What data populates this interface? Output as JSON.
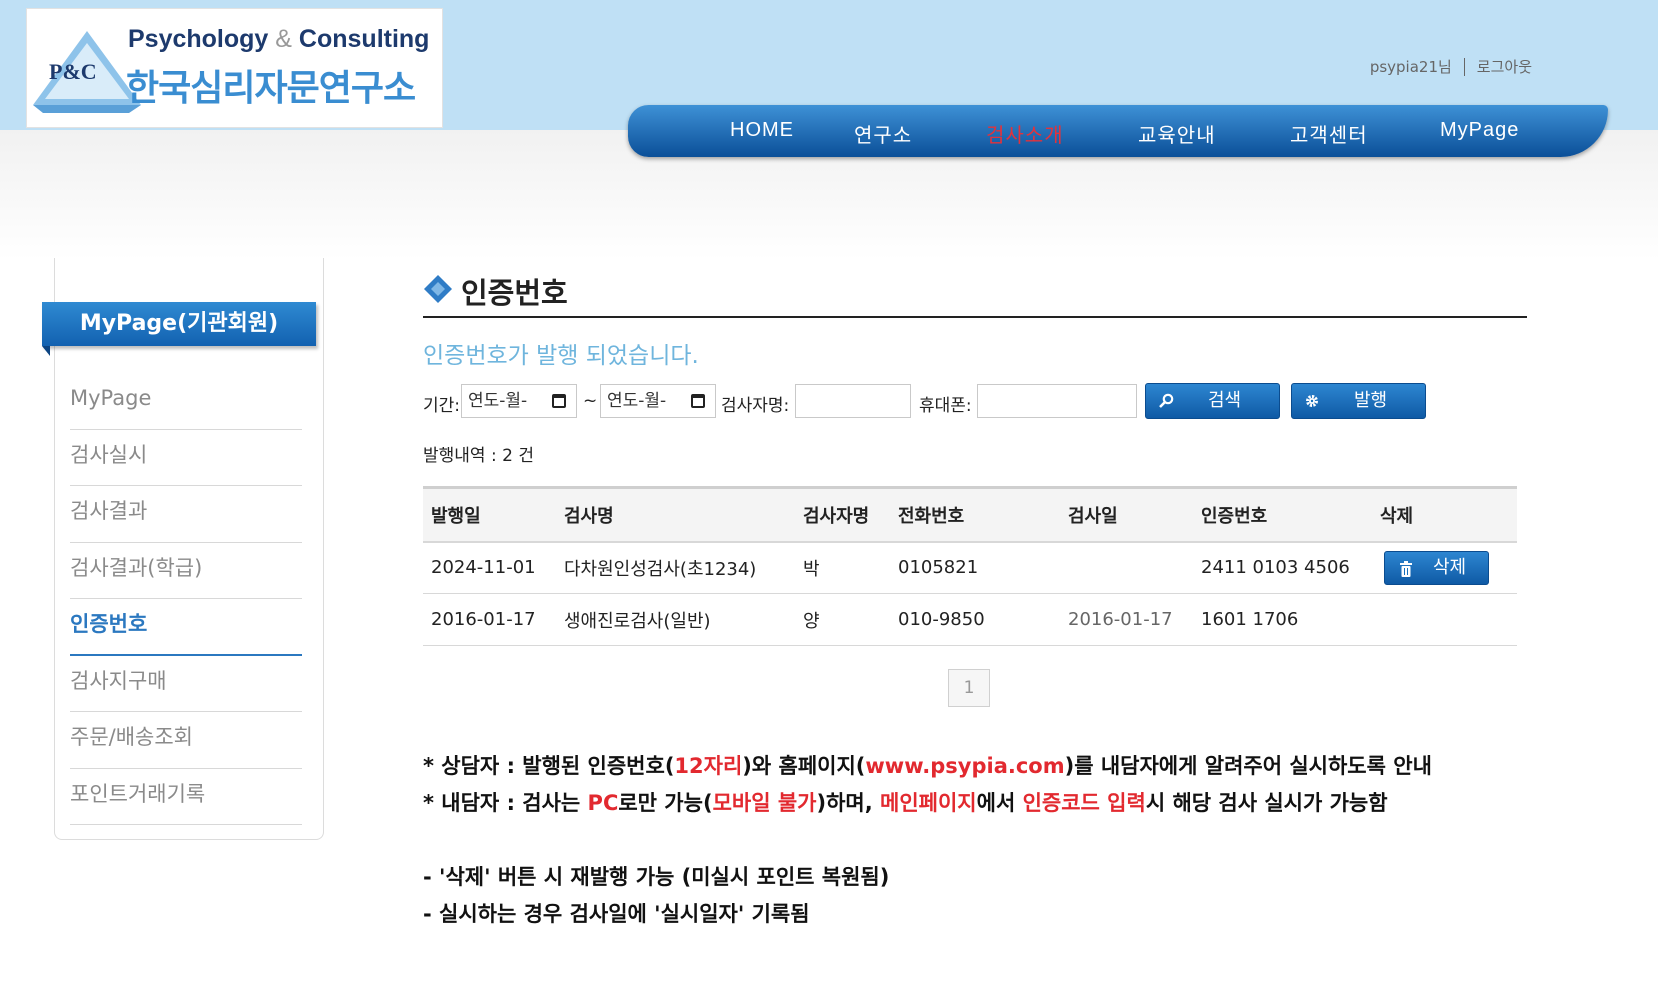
{
  "header": {
    "logo_mark_text": "P&C",
    "logo_sub_left": "Psychology",
    "logo_sub_amp": "&",
    "logo_sub_right": "Consulting",
    "logo_main": "한국심리자문연구소",
    "user_name": "psypia21님",
    "logout_label": "로그아웃"
  },
  "nav": {
    "items": [
      {
        "label": "HOME"
      },
      {
        "label": "연구소"
      },
      {
        "label": "검사소개"
      },
      {
        "label": "교육안내"
      },
      {
        "label": "고객센터"
      },
      {
        "label": "MyPage"
      }
    ],
    "active_color": "#e3323b"
  },
  "sidebar": {
    "title": "MyPage(기관회원)",
    "items": [
      {
        "label": "MyPage"
      },
      {
        "label": "검사실시"
      },
      {
        "label": "검사결과"
      },
      {
        "label": "검사결과(학급)"
      },
      {
        "label": "인증번호"
      },
      {
        "label": "검사지구매"
      },
      {
        "label": "주문/배송조회"
      },
      {
        "label": "포인트거래기록"
      }
    ],
    "active_index": 4
  },
  "main": {
    "title": "인증번호",
    "notice": "인증번호가 발행 되었습니다.",
    "filter": {
      "period_label": "기간:",
      "date_placeholder": "연도-월-",
      "tilde": "~",
      "name_label": "검사자명:",
      "phone_label": "휴대폰:",
      "search_button": "검색",
      "issue_button": "발행"
    },
    "count_text": "발행내역 : 2 건",
    "table": {
      "headers": [
        "발행일",
        "검사명",
        "검사자명",
        "전화번호",
        "검사일",
        "인증번호",
        "삭제"
      ],
      "rows": [
        {
          "issued": "2024-11-01",
          "test": "다차원인성검사(초1234)",
          "name": "박",
          "phone": "0105821",
          "tested": "",
          "code": "2411 0103 4506",
          "delete": "삭제"
        },
        {
          "issued": "2016-01-17",
          "test": "생애진로검사(일반)",
          "name": "양",
          "phone": "010-9850",
          "tested": "2016-01-17",
          "code": "1601 1706",
          "delete": ""
        }
      ]
    },
    "pager": "1",
    "notes": {
      "l1": {
        "a": "* 상담자 : 발행된 인증번호(",
        "b": "12자리",
        "c": ")와 홈페이지(",
        "d": "www.psypia.com",
        "e": ")를 내담자에게 알려주어 실시하도록 안내"
      },
      "l2": {
        "a": "* 내담자 : 검사는 ",
        "b": "PC",
        "c": "로만 가능(",
        "d": "모바일 불가",
        "e": ")하며, ",
        "f": "메인페이지",
        "g": "에서 ",
        "h": "인증코드 입력",
        "i": "시 해당 검사 실시가 가능함"
      },
      "l3": "- '삭제' 버튼 시 재발행 가능 (미실시 포인트 복원됨)",
      "l4": "- 실시하는 경우 검사일에 '실시일자' 기록됨"
    }
  },
  "colors": {
    "header_bg": "#bfe0f5",
    "nav_blue": "#0b4f98",
    "accent_blue": "#2b78c0",
    "notice_blue": "#6fb5dd",
    "highlight_red": "#e2292f"
  }
}
